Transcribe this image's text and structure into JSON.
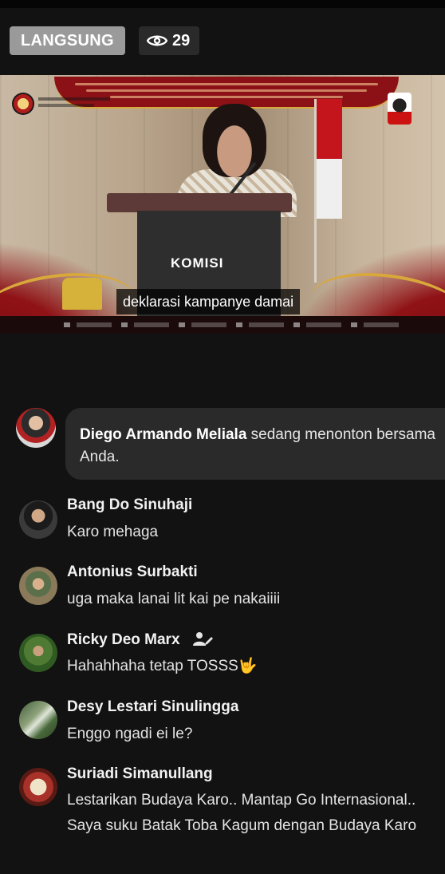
{
  "header": {
    "live_label": "LANGSUNG",
    "viewer_count": "29",
    "viewer_icon": "eye-icon"
  },
  "video": {
    "caption": "deklarasi kampanye damai",
    "podium_text": "KOMISI"
  },
  "joined_notice": {
    "name": "Diego Armando Meliala",
    "text": "sedang menonton bersama Anda."
  },
  "comments": [
    {
      "name": "Bang Do Sinuhaji",
      "text": "Karo mehaga"
    },
    {
      "name": "Antonius Surbakti",
      "text": "uga maka lanai lit kai pe nakaiiii"
    },
    {
      "name": "Ricky Deo Marx",
      "text": "Hahahhaha tetap TOSSS🤟",
      "badge_icon": "user-edit-icon"
    },
    {
      "name": "Desy Lestari Sinulingga",
      "text": "Enggo ngadi ei le?"
    },
    {
      "name": "Suriadi Simanullang",
      "text": "Lestarikan Budaya Karo.. Mantap Go Internasional.. Saya suku Batak Toba Kagum dengan Budaya Karo"
    }
  ],
  "colors": {
    "background": "#121212",
    "live_badge": "#9a9a9a",
    "bubble": "#2a2a2a",
    "banner_red": "#8c1116",
    "gold": "#d9a83a"
  }
}
